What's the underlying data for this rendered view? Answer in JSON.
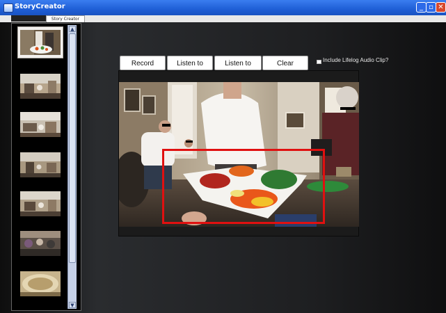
{
  "window": {
    "title": "StoryCreator",
    "tab_label": "Story Creator"
  },
  "toolbar": {
    "record_voice": "Record Voice",
    "listen_voice": "Listen to Voice",
    "listen_sounds": "Listen to Sounds",
    "clear_drawings": "Clear Drawings"
  },
  "include_clip": {
    "label": "Include Lifelog Audio Clip?",
    "checked": false
  },
  "thumbnails": [
    {
      "scene": "people-with-tray",
      "selected": true
    },
    {
      "scene": "living-room"
    },
    {
      "scene": "living-room"
    },
    {
      "scene": "living-room"
    },
    {
      "scene": "living-room"
    },
    {
      "scene": "crowd"
    },
    {
      "scene": "bowl"
    }
  ],
  "colors": {
    "accent_titlebar": "#1f5fd6",
    "highlight_box": "#e01010"
  }
}
